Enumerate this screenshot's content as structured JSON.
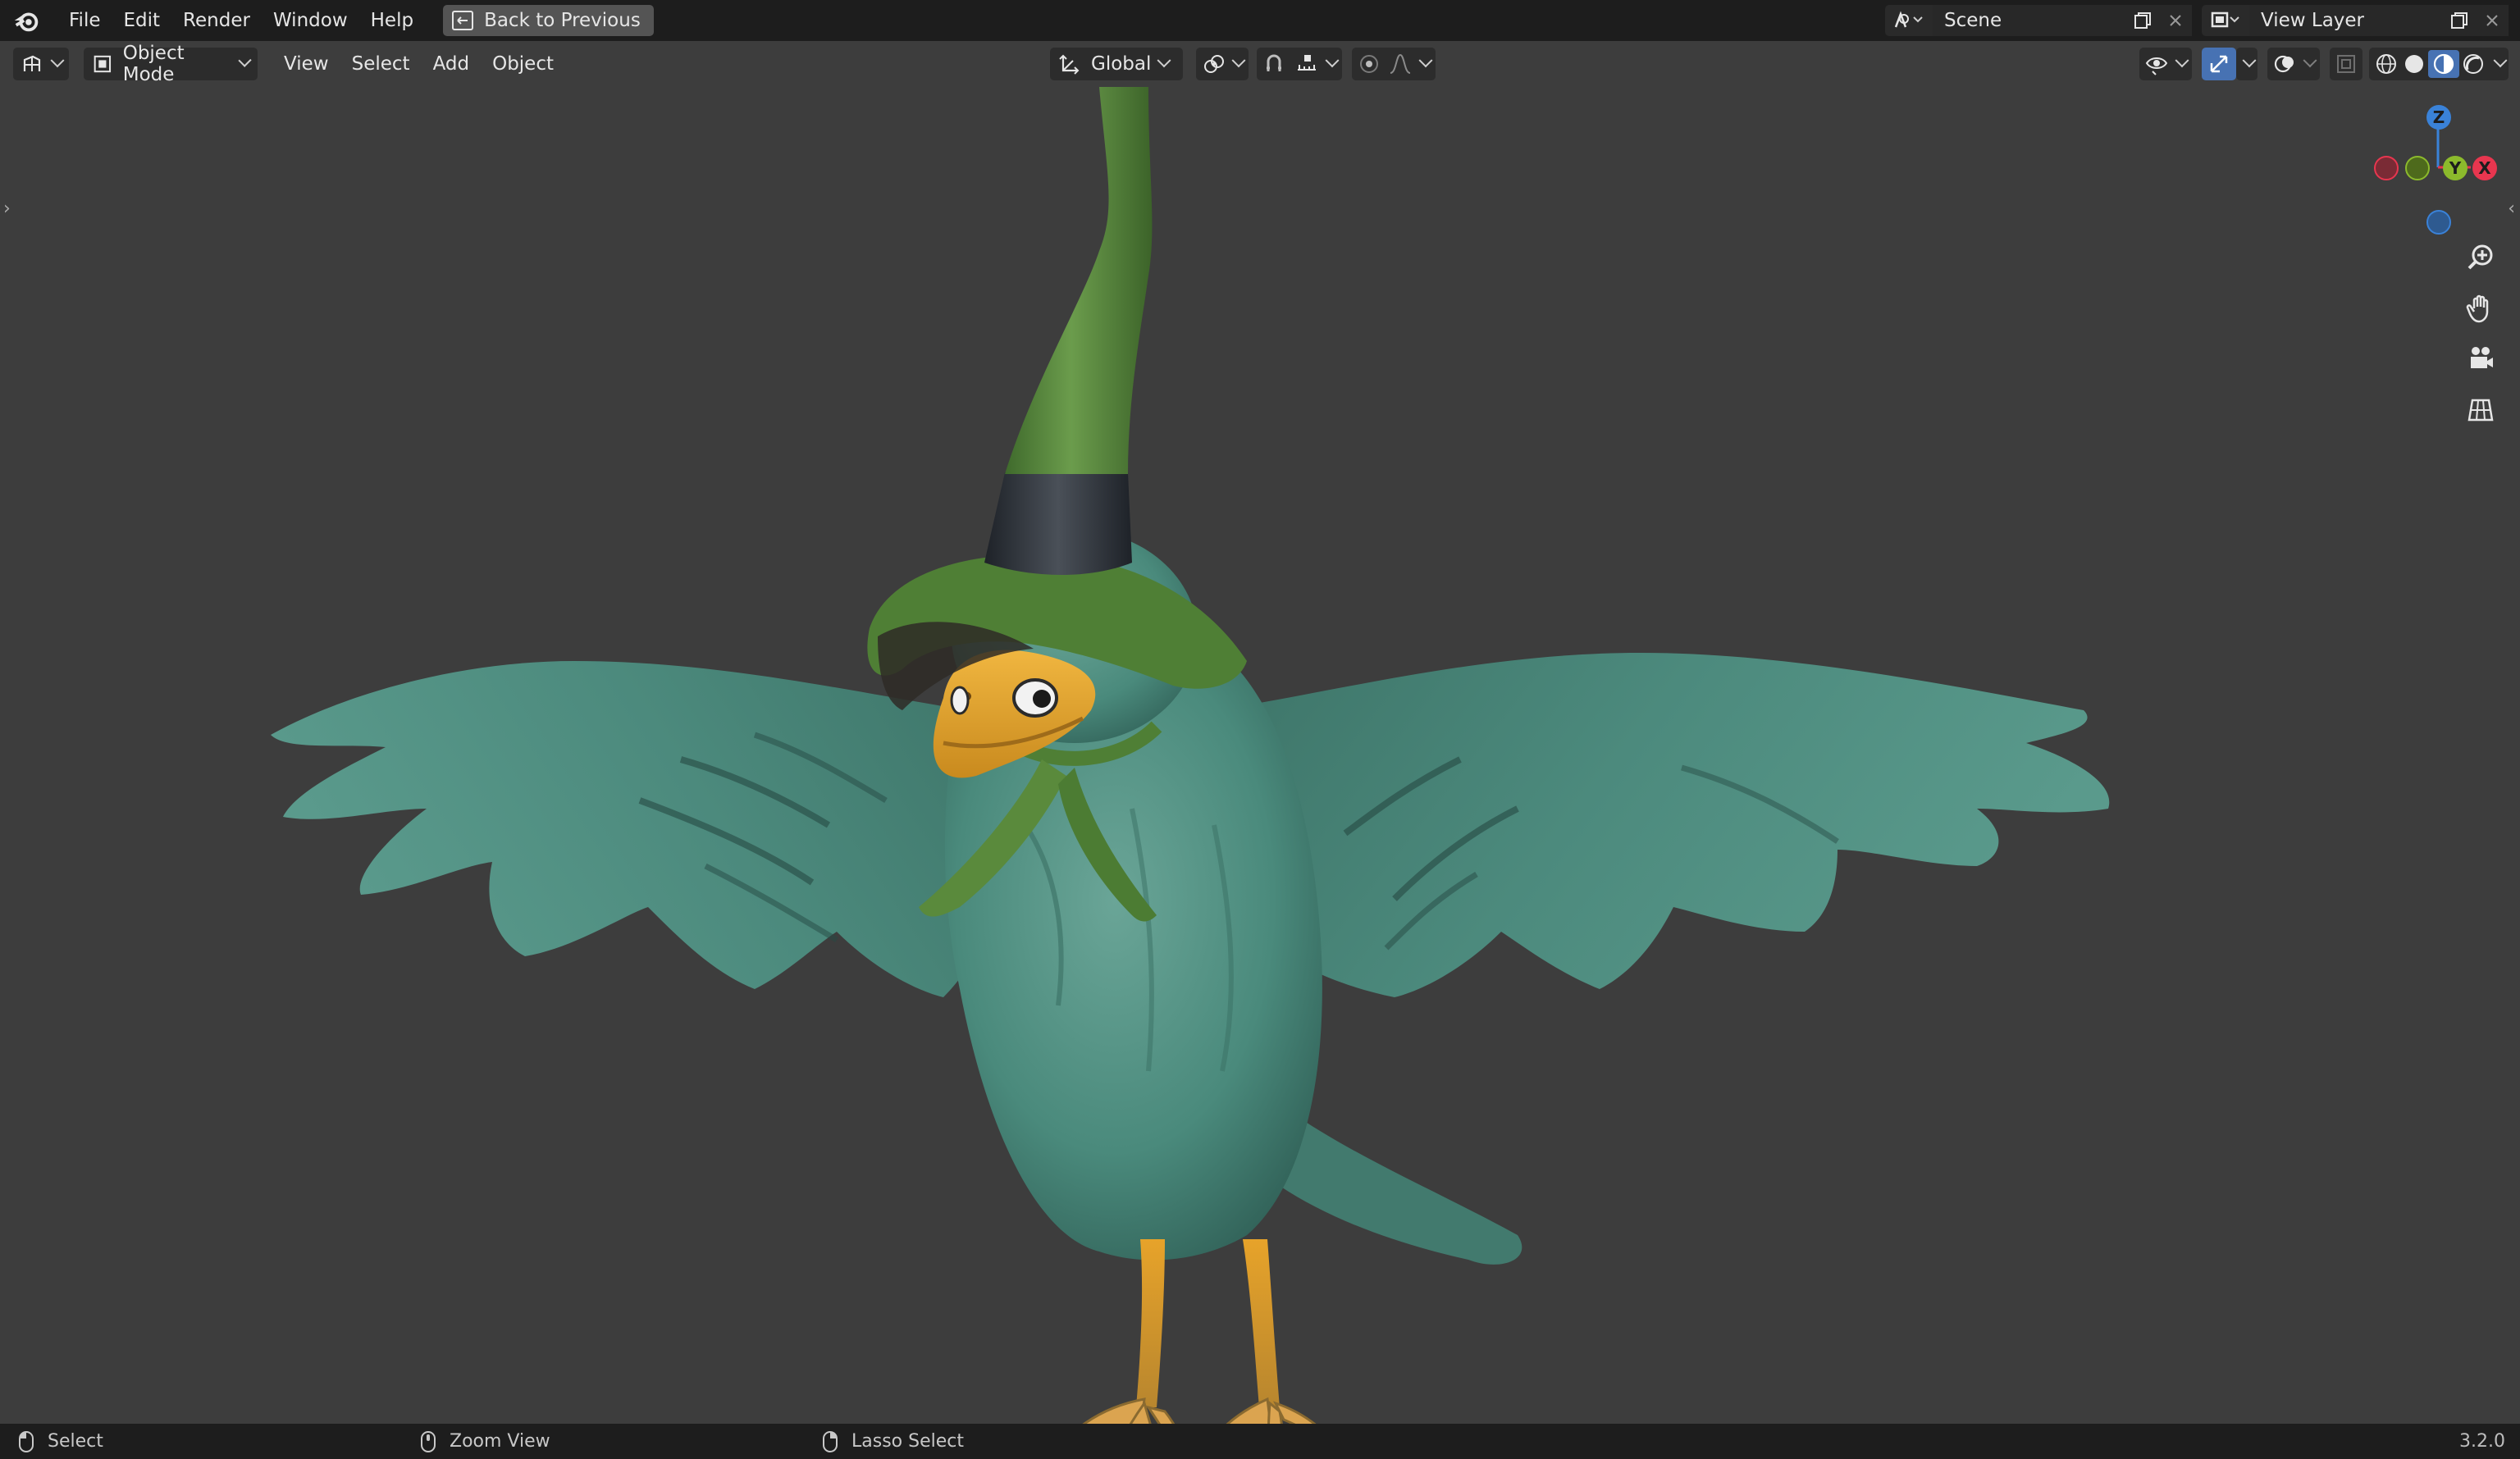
{
  "topbar": {
    "menus": [
      "File",
      "Edit",
      "Render",
      "Window",
      "Help"
    ],
    "back_button": "Back to Previous",
    "scene": "Scene",
    "view_layer": "View Layer"
  },
  "viewport_header": {
    "mode": "Object Mode",
    "menus": [
      "View",
      "Select",
      "Add",
      "Object"
    ],
    "transform_orientation": "Global"
  },
  "gizmo": {
    "z": "Z",
    "y": "Y",
    "x": "X"
  },
  "status_bar": {
    "select": "Select",
    "zoom": "Zoom View",
    "lasso": "Lasso Select",
    "version": "3.2.0"
  },
  "colors": {
    "viewport_bg": "#3d3d3d",
    "topbar_bg": "#1d1d1d",
    "accent_blue": "#4772b3",
    "axis_x": "#e8364f",
    "axis_y": "#8cba2c",
    "axis_z": "#3a82d8",
    "bird_teal": "#4a8a7c",
    "hat_green": "#5a8c3e",
    "beak_yellow": "#e3a22a"
  },
  "icons": [
    "blender-logo-icon",
    "back-icon",
    "editor-type-icon",
    "object-mode-icon",
    "orientation-icon",
    "pivot-icon",
    "snap-icon",
    "proportional-icon",
    "visibility-icon",
    "gizmo-icon",
    "overlay-icon",
    "xray-icon",
    "wireframe-shading-icon",
    "solid-shading-icon",
    "material-shading-icon",
    "rendered-shading-icon",
    "zoom-icon",
    "hand-pan-icon",
    "camera-icon",
    "grid-ortho-icon",
    "mouse-left-icon",
    "mouse-middle-icon",
    "mouse-right-icon"
  ]
}
